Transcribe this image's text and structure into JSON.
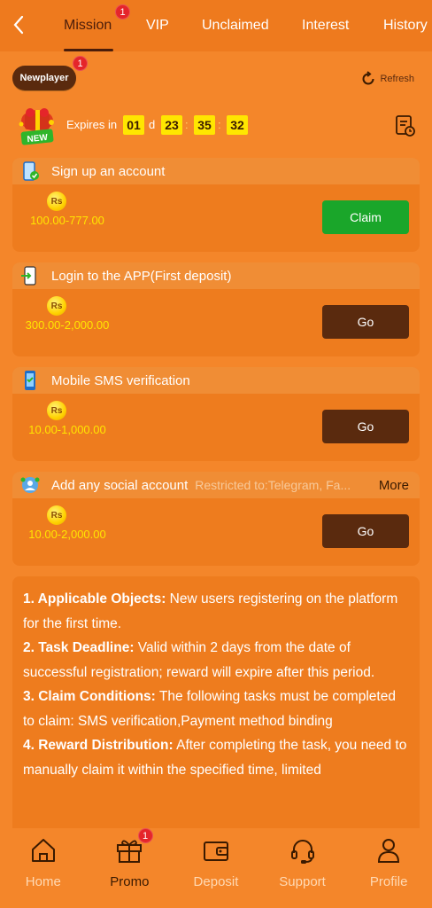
{
  "header": {
    "tabs": [
      {
        "label": "Mission",
        "badge": "1"
      },
      {
        "label": "VIP"
      },
      {
        "label": "Unclaimed"
      },
      {
        "label": "Interest"
      },
      {
        "label": "History"
      }
    ]
  },
  "player": {
    "label": "Newplayer",
    "badge": "1"
  },
  "refresh_label": "Refresh",
  "gift_tag": "NEW",
  "countdown": {
    "label": "Expires in",
    "days": "01",
    "days_unit": "d",
    "hours": "23",
    "minutes": "35",
    "seconds": "32",
    "separator": ":"
  },
  "tasks": [
    {
      "title": "Sign up an account",
      "currency": "Rs",
      "amount": "100.00-777.00",
      "button": "Claim"
    },
    {
      "title": "Login to the APP(First deposit)",
      "currency": "Rs",
      "amount": "300.00-2,000.00",
      "button": "Go"
    },
    {
      "title": "Mobile SMS verification",
      "currency": "Rs",
      "amount": "10.00-1,000.00",
      "button": "Go"
    },
    {
      "title": "Add any social account",
      "restriction": "Restricted to:Telegram, Fa...",
      "more": "More",
      "currency": "Rs",
      "amount": "10.00-2,000.00",
      "button": "Go"
    }
  ],
  "rules": [
    {
      "heading": "1. Applicable Objects:",
      "text": " New users registering on the platform for the first time."
    },
    {
      "heading": "2. Task Deadline:",
      "text": " Valid within 2 days from the date of successful registration; reward will expire after this period."
    },
    {
      "heading": "3. Claim Conditions:",
      "text": " The following tasks must be completed to claim: SMS verification,Payment method binding"
    },
    {
      "heading": "4. Reward Distribution:",
      "text": " After completing the task, you need to manually claim it within the specified time, limited"
    }
  ],
  "nav": [
    {
      "label": "Home"
    },
    {
      "label": "Promo",
      "badge": "1"
    },
    {
      "label": "Deposit"
    },
    {
      "label": "Support"
    },
    {
      "label": "Profile"
    }
  ],
  "colors": {
    "background": "#f4862a",
    "card": "#ee7c1e",
    "dark_brown": "#5a2a0e",
    "claim_green": "#1aa62a",
    "timer_yellow": "#ffe600",
    "badge_red": "#e5252a"
  }
}
